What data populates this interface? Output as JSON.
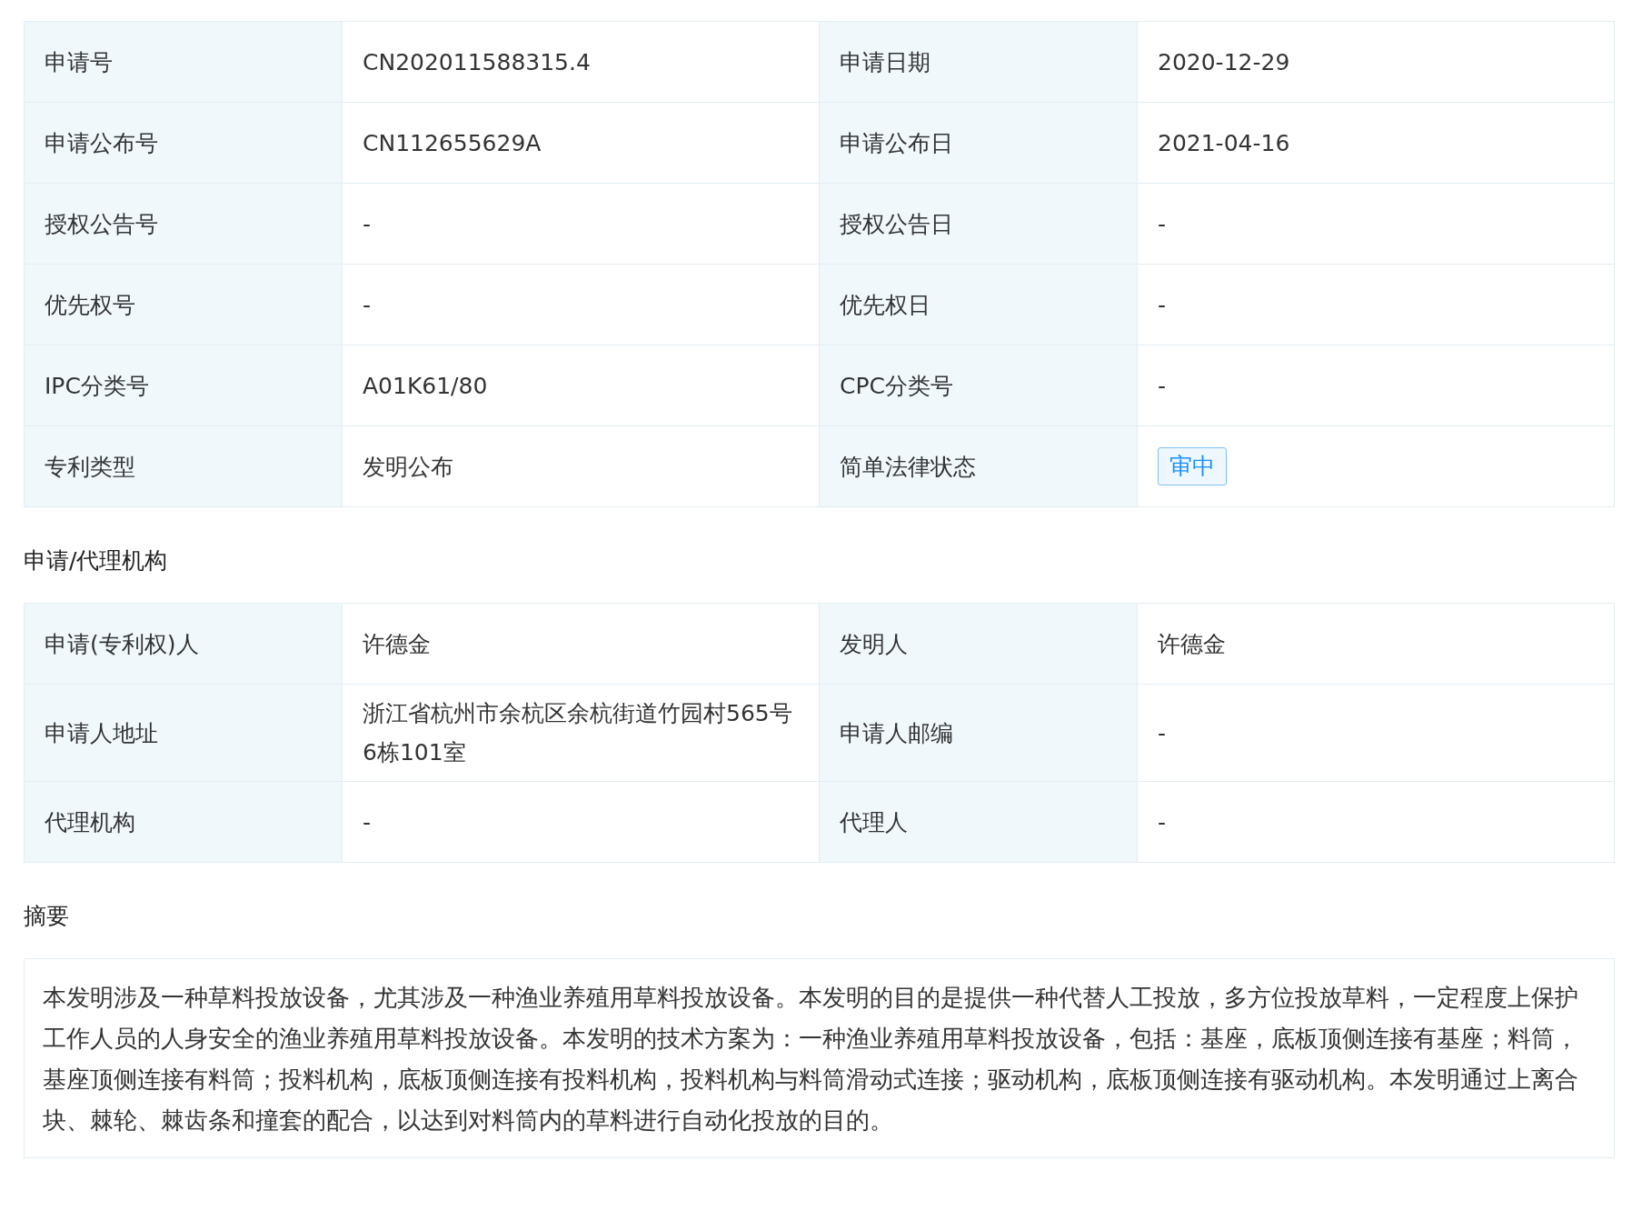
{
  "basic_table": {
    "rows": [
      {
        "cells": [
          {
            "label": "申请号",
            "value": "CN202011588315.4",
            "kind": "text"
          },
          {
            "label": "申请日期",
            "value": "2020-12-29",
            "kind": "text"
          }
        ]
      },
      {
        "cells": [
          {
            "label": "申请公布号",
            "value": "CN112655629A",
            "kind": "text"
          },
          {
            "label": "申请公布日",
            "value": "2021-04-16",
            "kind": "text"
          }
        ]
      },
      {
        "cells": [
          {
            "label": "授权公告号",
            "value": "-",
            "kind": "text"
          },
          {
            "label": "授权公告日",
            "value": "-",
            "kind": "text"
          }
        ]
      },
      {
        "cells": [
          {
            "label": "优先权号",
            "value": "-",
            "kind": "text"
          },
          {
            "label": "优先权日",
            "value": "-",
            "kind": "text"
          }
        ]
      },
      {
        "cells": [
          {
            "label": "IPC分类号",
            "value": "A01K61/80",
            "kind": "text"
          },
          {
            "label": "CPC分类号",
            "value": "-",
            "kind": "text"
          }
        ]
      },
      {
        "cells": [
          {
            "label": "专利类型",
            "value": "发明公布",
            "kind": "text"
          },
          {
            "label": "简单法律状态",
            "value": "审中",
            "kind": "tag"
          }
        ]
      }
    ]
  },
  "agency_section": {
    "title": "申请/代理机构",
    "rows": [
      {
        "cells": [
          {
            "label": "申请(专利权)人",
            "value": "许德金",
            "kind": "text"
          },
          {
            "label": "发明人",
            "value": "许德金",
            "kind": "text"
          }
        ]
      },
      {
        "cells": [
          {
            "label": "申请人地址",
            "value": "浙江省杭州市余杭区余杭街道竹园村565号6栋101室",
            "kind": "text"
          },
          {
            "label": "申请人邮编",
            "value": "-",
            "kind": "text"
          }
        ]
      },
      {
        "cells": [
          {
            "label": "代理机构",
            "value": "-",
            "kind": "text"
          },
          {
            "label": "代理人",
            "value": "-",
            "kind": "text"
          }
        ]
      }
    ]
  },
  "abstract_section": {
    "title": "摘要",
    "text": "本发明涉及一种草料投放设备，尤其涉及一种渔业养殖用草料投放设备。本发明的目的是提供一种代替人工投放，多方位投放草料，一定程度上保护工作人员的人身安全的渔业养殖用草料投放设备。本发明的技术方案为：一种渔业养殖用草料投放设备，包括：基座，底板顶侧连接有基座；料筒，基座顶侧连接有料筒；投料机构，底板顶侧连接有投料机构，投料机构与料筒滑动式连接；驱动机构，底板顶侧连接有驱动机构。本发明通过上离合块、棘轮、棘齿条和撞套的配合，以达到对料筒内的草料进行自动化投放的目的。"
  }
}
